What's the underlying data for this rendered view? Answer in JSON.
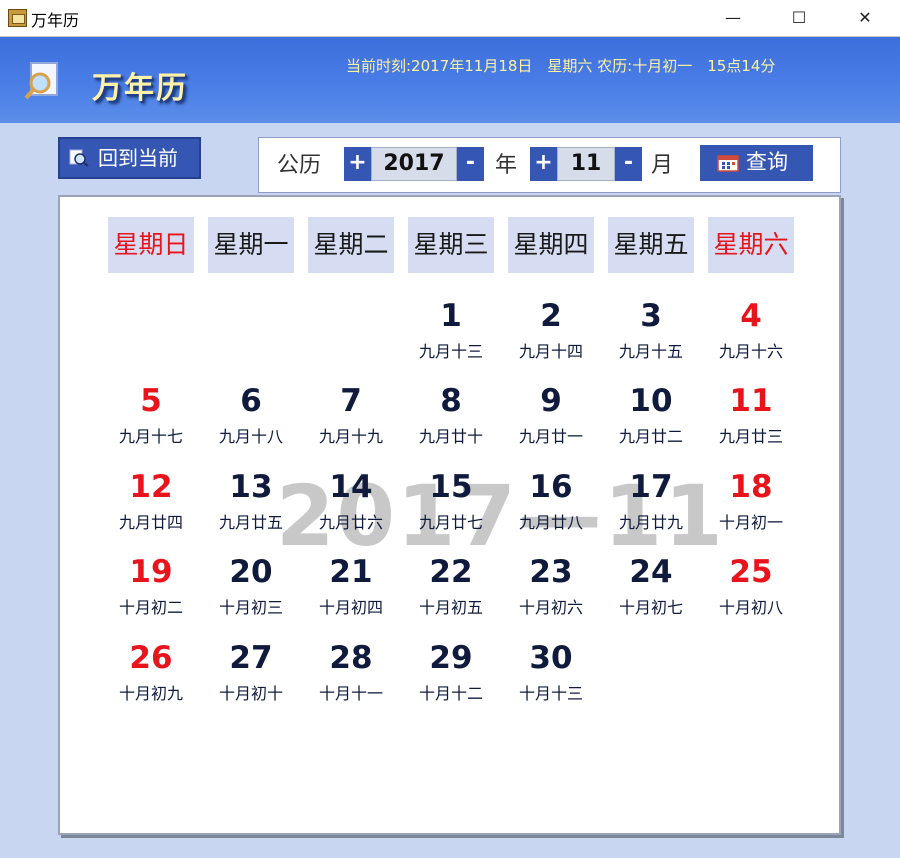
{
  "window": {
    "title": "万年历",
    "minimize": "—",
    "maximize": "☐",
    "close": "✕"
  },
  "banner": {
    "title": "万年历",
    "time_text": "当前时刻:2017年11月18日　星期六  农历:十月初一　15点14分"
  },
  "controls": {
    "back_label": "回到当前",
    "gongli_label": "公历",
    "year_value": "2017",
    "year_unit": "年",
    "month_value": "11",
    "month_unit": "月",
    "plus": "+",
    "minus": "-",
    "query_label": "查询"
  },
  "calendar": {
    "watermark": "2017—11",
    "weekdays": [
      "星期日",
      "星期一",
      "星期二",
      "星期三",
      "星期四",
      "星期五",
      "星期六"
    ],
    "first_weekday": 3,
    "days": [
      {
        "d": "1",
        "l": "九月十三"
      },
      {
        "d": "2",
        "l": "九月十四"
      },
      {
        "d": "3",
        "l": "九月十五"
      },
      {
        "d": "4",
        "l": "九月十六"
      },
      {
        "d": "5",
        "l": "九月十七"
      },
      {
        "d": "6",
        "l": "九月十八"
      },
      {
        "d": "7",
        "l": "九月十九"
      },
      {
        "d": "8",
        "l": "九月廿十"
      },
      {
        "d": "9",
        "l": "九月廿一"
      },
      {
        "d": "10",
        "l": "九月廿二"
      },
      {
        "d": "11",
        "l": "九月廿三"
      },
      {
        "d": "12",
        "l": "九月廿四"
      },
      {
        "d": "13",
        "l": "九月廿五"
      },
      {
        "d": "14",
        "l": "九月廿六"
      },
      {
        "d": "15",
        "l": "九月廿七"
      },
      {
        "d": "16",
        "l": "九月廿八"
      },
      {
        "d": "17",
        "l": "九月廿九"
      },
      {
        "d": "18",
        "l": "十月初一"
      },
      {
        "d": "19",
        "l": "十月初二"
      },
      {
        "d": "20",
        "l": "十月初三"
      },
      {
        "d": "21",
        "l": "十月初四"
      },
      {
        "d": "22",
        "l": "十月初五"
      },
      {
        "d": "23",
        "l": "十月初六"
      },
      {
        "d": "24",
        "l": "十月初七"
      },
      {
        "d": "25",
        "l": "十月初八"
      },
      {
        "d": "26",
        "l": "十月初九"
      },
      {
        "d": "27",
        "l": "十月初十"
      },
      {
        "d": "28",
        "l": "十月十一"
      },
      {
        "d": "29",
        "l": "十月十二"
      },
      {
        "d": "30",
        "l": "十月十三"
      }
    ]
  },
  "colors": {
    "weekend": "#e8141c",
    "weekday": "#0f1a3c",
    "accent": "#3556b3"
  }
}
